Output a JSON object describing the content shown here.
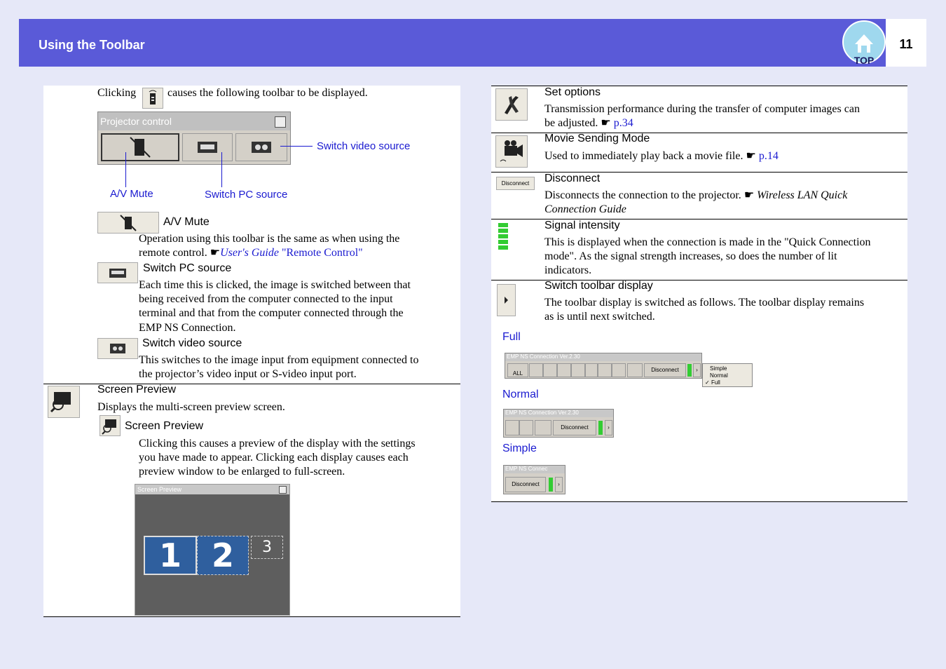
{
  "header": {
    "title": "Using the Toolbar",
    "page_number": "11",
    "top_label": "TOP"
  },
  "left": {
    "intro_before": "Clicking",
    "intro_after": "causes the following toolbar to be displayed.",
    "projector_window_title": "Projector control",
    "callout_av_mute": "A/V Mute",
    "callout_switch_pc": "Switch PC source",
    "callout_switch_video": "Switch video source",
    "av_mute": {
      "title": "A/V Mute",
      "desc_1": "Operation using this toolbar is the same as when using the",
      "desc_2a": "remote control.",
      "desc_2_link_italic": "User's Guide",
      "desc_2_link": "\"Remote Control\""
    },
    "switch_pc": {
      "title": "Switch PC source",
      "lines": [
        "Each time this is clicked, the image is switched between that",
        "being received from the computer connected to the input",
        "terminal and that from the computer connected through the",
        "EMP NS Connection."
      ]
    },
    "switch_video": {
      "title": "Switch video source",
      "lines": [
        "This switches to the image input from equipment connected to",
        "the projector’s video input or S-video input port."
      ]
    },
    "screen_preview": {
      "title": "Screen Preview",
      "desc": "Displays the multi-screen preview screen.",
      "sub_title": "Screen Preview",
      "sub_lines": [
        "Clicking this causes a preview of the display with the settings",
        "you have made to appear. Clicking each display causes each",
        "preview window to be enlarged to full-screen."
      ],
      "window_title": "Screen Preview",
      "screens": [
        "1",
        "2",
        "3"
      ]
    }
  },
  "right": {
    "set_options": {
      "title": "Set options",
      "line1": "Transmission performance during the transfer of computer images can",
      "line2": "be adjusted.",
      "link": "p.34"
    },
    "movie_mode": {
      "title": "Movie Sending Mode",
      "line1": "Used to immediately play back a movie file.",
      "link": "p.14"
    },
    "disconnect": {
      "title": "Disconnect",
      "button_label": "Disconnect",
      "line1": "Disconnects the connection to the projector.",
      "line1_italic": "Wireless LAN Quick",
      "line2_italic": "Connection Guide"
    },
    "signal": {
      "title": "Signal intensity",
      "lines": [
        "This is displayed when the connection is made in the \"Quick Connection",
        "mode\". As the signal strength increases, so does the number of lit",
        "indicators."
      ]
    },
    "switch_toolbar": {
      "title": "Switch toolbar display",
      "lines": [
        "The toolbar display is switched as follows. The toolbar display remains",
        "as is until next switched."
      ]
    },
    "modes": {
      "full_label": "Full",
      "normal_label": "Normal",
      "simple_label": "Simple",
      "full_window_title": "EMP NS Connection",
      "full_window_version": "Ver.2.30",
      "normal_window_title": "EMP NS Connection",
      "normal_window_version": "Ver.2.30",
      "simple_window_title": "EMP NS Connec",
      "disconnect": "Disconnect",
      "all_label": "ALL",
      "menu_items": [
        "Simple",
        "Normal",
        "Full"
      ]
    }
  },
  "colors": {
    "header_bg": "#5a5ad8",
    "link": "#1a1ad0",
    "page_bg": "#e6e8f8",
    "signal_green": "#33cc33"
  }
}
